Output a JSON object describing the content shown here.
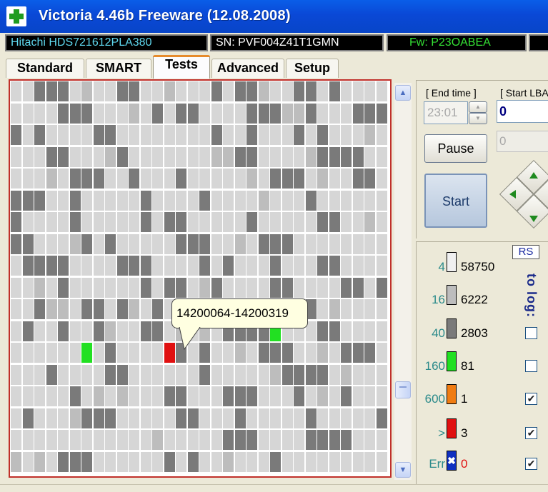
{
  "window": {
    "title": "Victoria 4.46b Freeware (12.08.2008)"
  },
  "device": {
    "model": "Hitachi HDS721612PLA380",
    "serial": "SN: PVF004Z41T1GMN",
    "firmware": "Fw: P23OABEA"
  },
  "colors": {
    "accent": "#e68b2c",
    "grid_border": "#c0302a",
    "cell_light": "#d6d6d6",
    "cell_mid": "#bdbdbd",
    "cell_dark": "#7a7a7a",
    "cell_green": "#22e022",
    "cell_orange": "#f07c12",
    "cell_red": "#e01010"
  },
  "tabs": [
    {
      "label": "Standard",
      "active": false
    },
    {
      "label": "SMART",
      "active": false
    },
    {
      "label": "Tests",
      "active": true
    },
    {
      "label": "Advanced",
      "active": false
    },
    {
      "label": "Setup",
      "active": false
    }
  ],
  "tooltip": {
    "text": "14200064-14200319"
  },
  "controls": {
    "end_time_label": "[ End time ]",
    "start_lba_label": "[ Start LBA",
    "end_time_value": "23:01",
    "start_lba_value": "0",
    "second_field_value": "0",
    "pause_label": "Pause",
    "start_label": "Start"
  },
  "legend": {
    "rs_label": "RS",
    "to_log_label": "to log:",
    "rows": [
      {
        "threshold": "4",
        "count": "58750",
        "swatch": "#e0e0e0",
        "icon": "light-gray-block"
      },
      {
        "threshold": "16",
        "count": "6222",
        "swatch": "#bdbdbd",
        "icon": "gray-block"
      },
      {
        "threshold": "40",
        "count": "2803",
        "swatch": "#7a7a7a",
        "icon": "dark-gray-block",
        "log": false
      },
      {
        "threshold": "160",
        "count": "81",
        "swatch": "#22e022",
        "icon": "green-block",
        "log": false
      },
      {
        "threshold": "600",
        "count": "1",
        "swatch": "#f07c12",
        "icon": "orange-block",
        "log": true
      },
      {
        "threshold": ">",
        "count": "3",
        "swatch": "#e01010",
        "icon": "red-block",
        "log": true
      },
      {
        "threshold": "Err",
        "count": "0",
        "swatch": "#1030c0",
        "icon": "error-block",
        "log": true
      }
    ]
  }
}
